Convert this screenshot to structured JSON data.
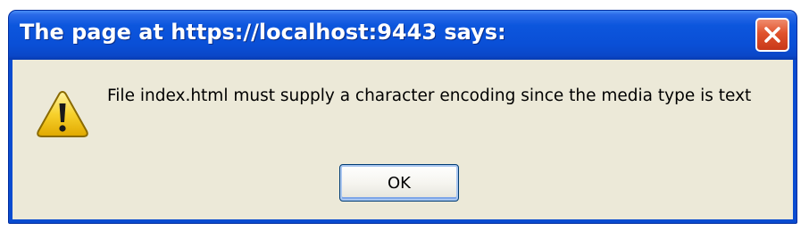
{
  "dialog": {
    "title": "The page at https://localhost:9443 says:",
    "message": "File index.html must supply a character encoding since the media type is text",
    "ok_label": "OK"
  },
  "icons": {
    "close": "close-icon",
    "warning": "warning-icon"
  },
  "colors": {
    "titlebar_blue": "#0a4fd6",
    "close_red": "#e0522c",
    "client_bg": "#ece9d8",
    "warning_yellow": "#f7d12c"
  }
}
